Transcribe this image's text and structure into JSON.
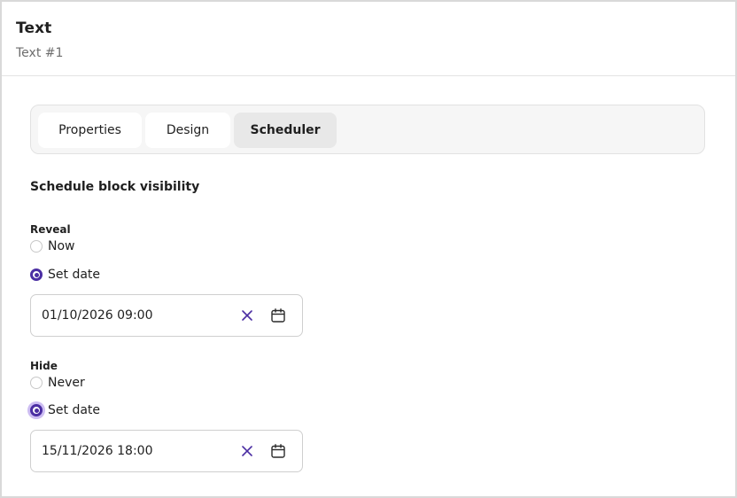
{
  "header": {
    "title": "Text",
    "subtitle": "Text #1"
  },
  "tabs": [
    {
      "label": "Properties",
      "active": false
    },
    {
      "label": "Design",
      "active": false
    },
    {
      "label": "Scheduler",
      "active": true
    }
  ],
  "scheduler": {
    "heading": "Schedule block visibility",
    "reveal": {
      "label": "Reveal",
      "options": [
        {
          "label": "Now",
          "checked": false
        },
        {
          "label": "Set date",
          "checked": true
        }
      ],
      "date_value": "01/10/2026 09:00"
    },
    "hide": {
      "label": "Hide",
      "options": [
        {
          "label": "Never",
          "checked": false
        },
        {
          "label": "Set date",
          "checked": true
        }
      ],
      "date_value": "15/11/2026 18:00"
    }
  },
  "colors": {
    "accent": "#4b2ea3",
    "clear_icon": "#4b2ea3"
  },
  "icons": {
    "clear": "close-icon",
    "calendar": "calendar-icon"
  }
}
